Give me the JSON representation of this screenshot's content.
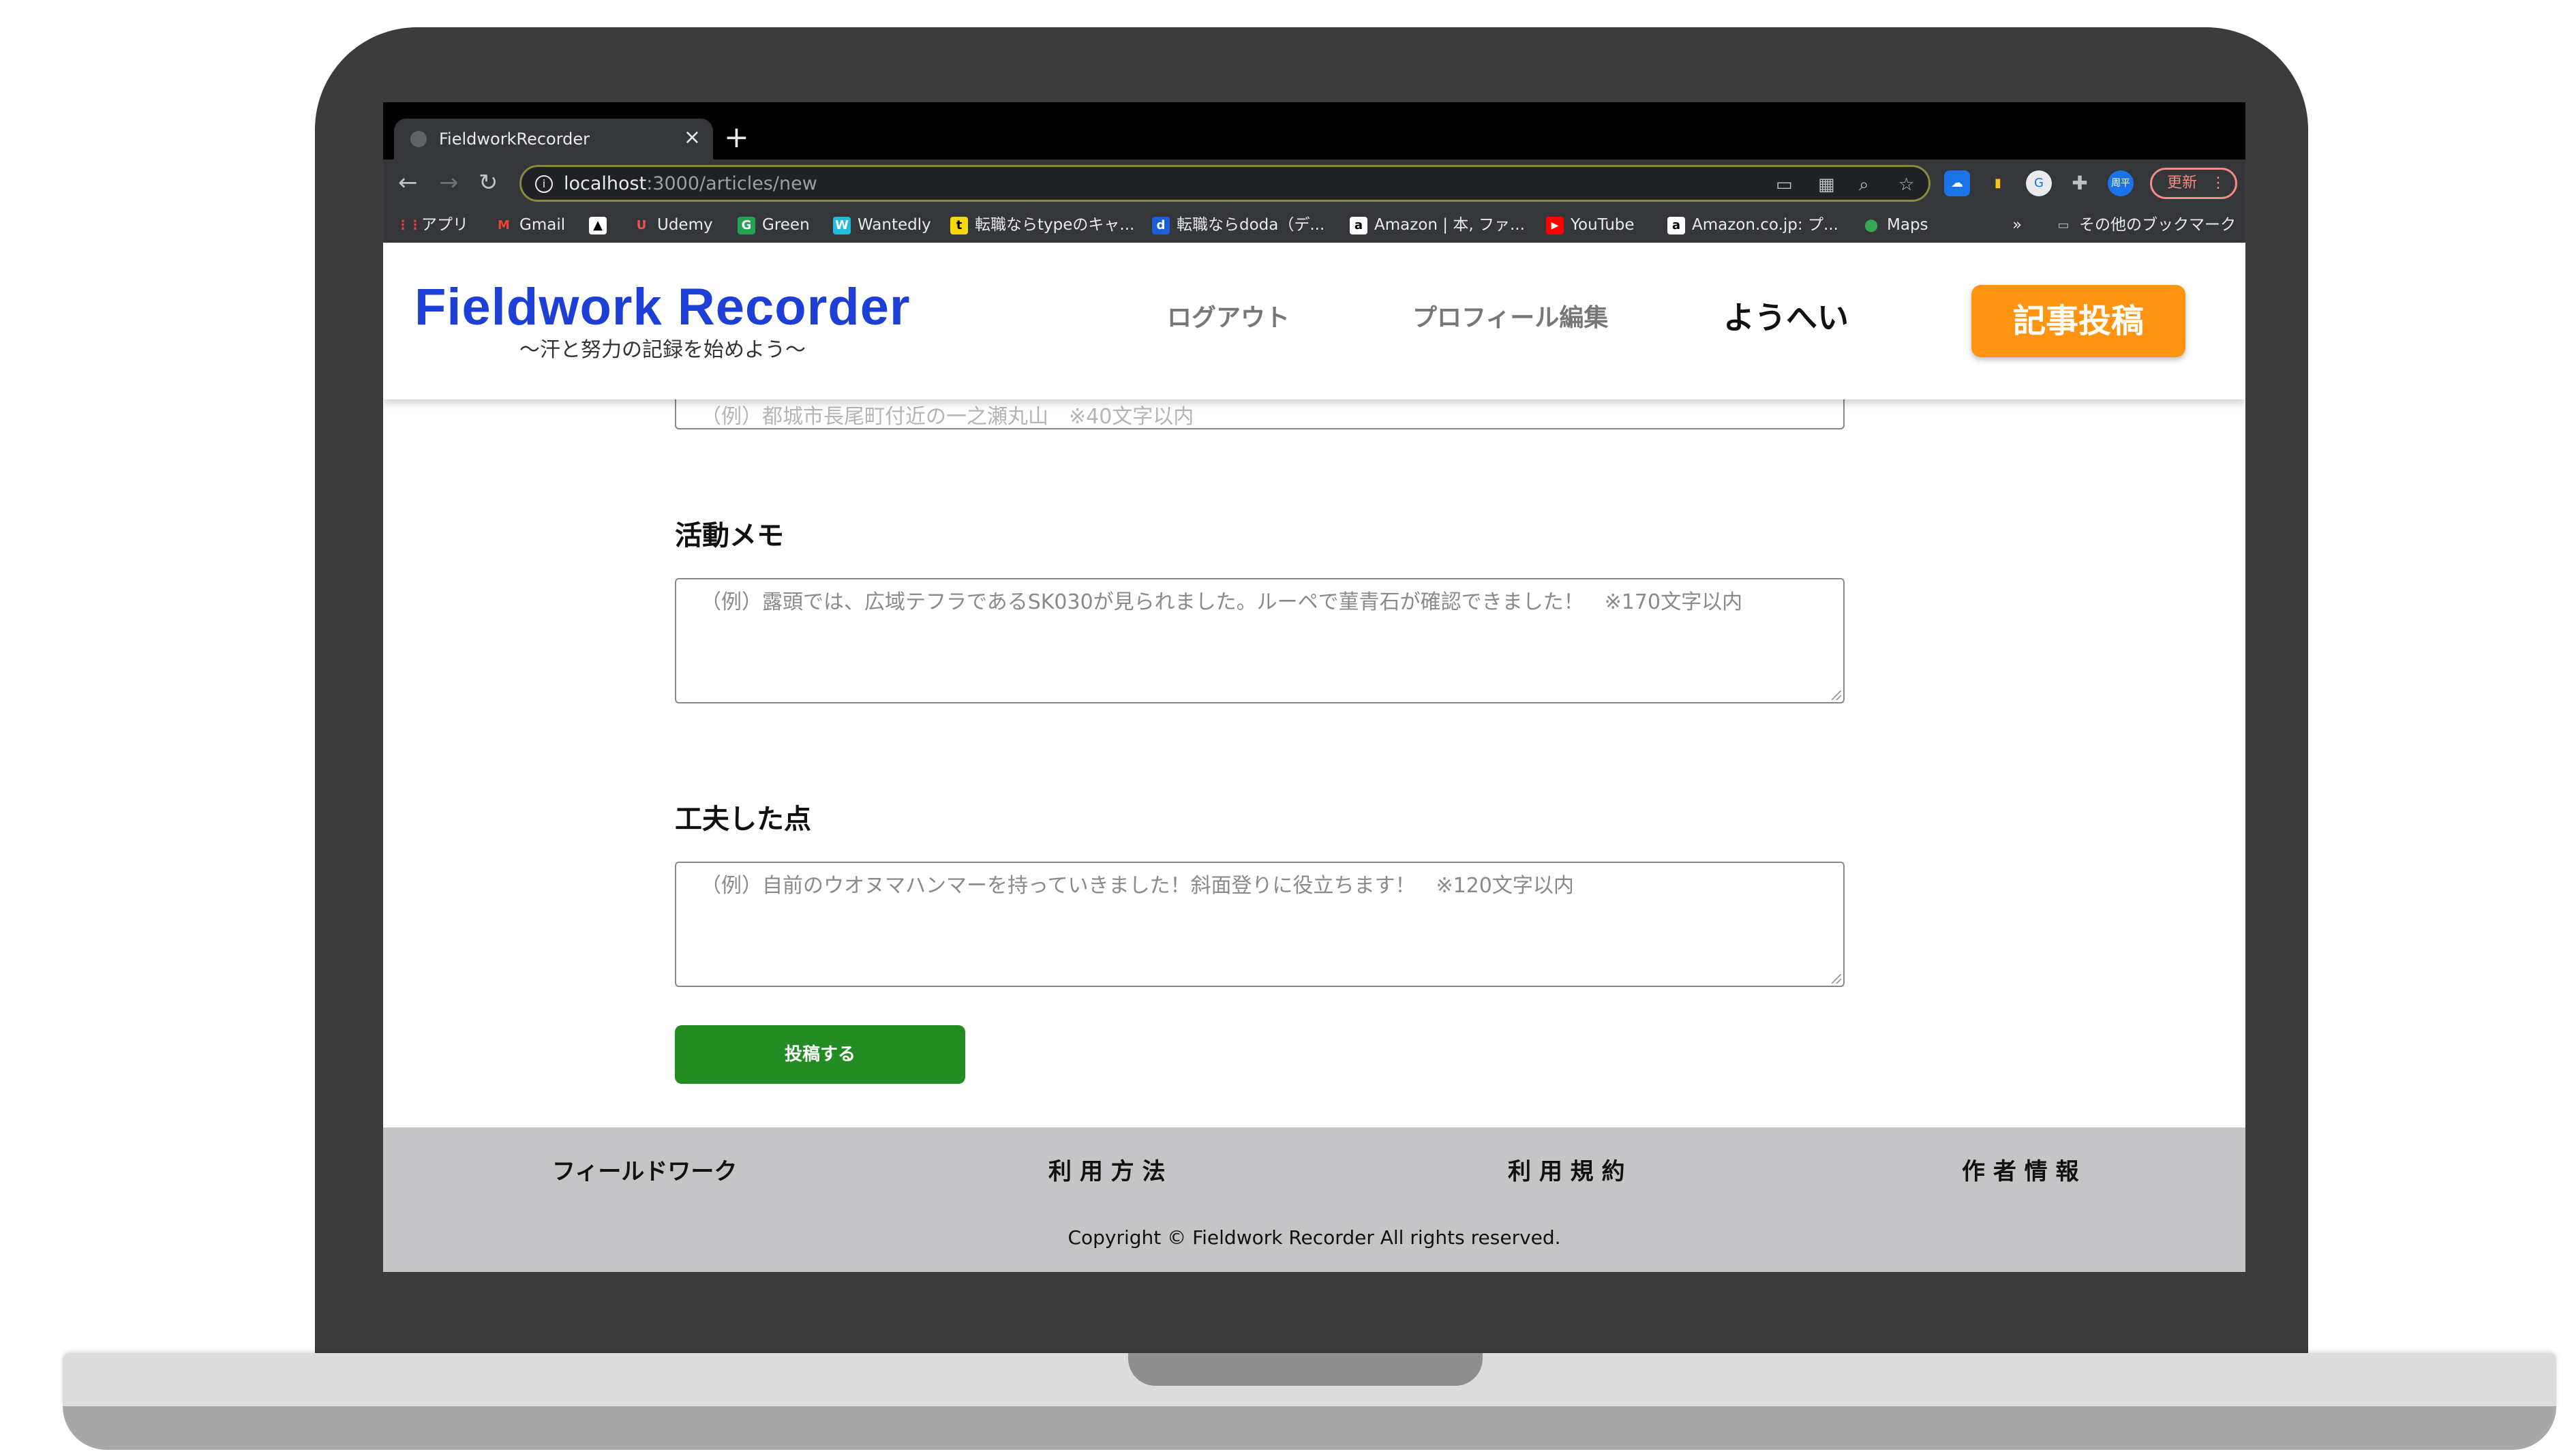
{
  "browser": {
    "tab_title": "FieldworkRecorder",
    "tab_close": "×",
    "new_tab": "+",
    "url_host": "localhost",
    "url_rest": ":3000/articles/new",
    "update_label": "更新",
    "profile_badge": "周平",
    "bookmarks": [
      {
        "label": "アプリ",
        "icon": "apps-grid-icon",
        "color": "#ea4335"
      },
      {
        "label": "Gmail",
        "icon": "gmail-icon",
        "color": "#ea4335"
      },
      {
        "label": "",
        "icon": "atcoder-icon",
        "color": "#ffffff"
      },
      {
        "label": "Udemy",
        "icon": "udemy-icon",
        "color": "#ec5252"
      },
      {
        "label": "Green",
        "icon": "green-icon",
        "color": "#23a455"
      },
      {
        "label": "Wantedly",
        "icon": "wantedly-icon",
        "color": "#21bddb"
      },
      {
        "label": "転職ならtypeのキャ...",
        "icon": "type-icon",
        "color": "#f5d90a"
      },
      {
        "label": "転職ならdoda（デ...",
        "icon": "doda-icon",
        "color": "#1a5fd3"
      },
      {
        "label": "Amazon | 本, ファ...",
        "icon": "amazon-icon",
        "color": "#ffffff"
      },
      {
        "label": "YouTube",
        "icon": "youtube-icon",
        "color": "#ff0000"
      },
      {
        "label": "Amazon.co.jp: プ...",
        "icon": "amazon-icon",
        "color": "#ffffff"
      },
      {
        "label": "Maps",
        "icon": "maps-icon",
        "color": "#34a853"
      }
    ],
    "more_bookmarks": "»",
    "other_bookmarks": "その他のブックマーク"
  },
  "header": {
    "logo": "Fieldwork Recorder",
    "tagline": "〜汗と努力の記録を始めよう〜",
    "nav_logout": "ログアウト",
    "nav_profile": "プロフィール編集",
    "nav_welcome": "ようへい",
    "post_button": "記事投稿"
  },
  "form": {
    "top_field_placeholder": "（例）都城市長尾町付近の一之瀬丸山　※40文字以内",
    "memo_label": "活動メモ",
    "memo_placeholder": "（例）露頭では、広域テフラであるSK030が見られました。ルーペで菫青石が確認できました！　※170文字以内",
    "tips_label": "工夫した点",
    "tips_placeholder": "（例）自前のウオヌマハンマーを持っていきました！斜面登りに役立ちます！　※120文字以内",
    "submit_label": "投稿する"
  },
  "footer": {
    "links": [
      "フィールドワーク",
      "利 用 方 法",
      "利 用 規 約",
      "作 者 情 報"
    ],
    "copyright": "Copyright © Fieldwork Recorder All rights reserved."
  },
  "colors": {
    "brand_blue": "#1d3fd6",
    "accent_orange": "#ff9411",
    "submit_green": "#228b22",
    "footer_gray": "#c5c4c6"
  }
}
